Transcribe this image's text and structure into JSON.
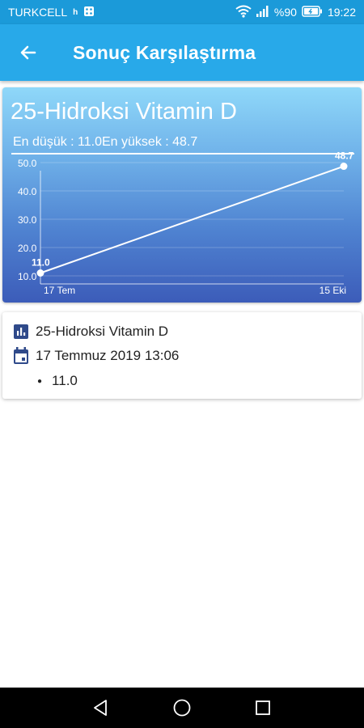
{
  "status_bar": {
    "carrier": "TURKCELL",
    "network_type": "h",
    "battery": "%90",
    "time": "19:22",
    "icons": [
      "sim-icon",
      "wifi-icon",
      "signal-icon",
      "battery-icon"
    ]
  },
  "app_bar": {
    "title": "Sonuç Karşılaştırma",
    "back_icon": "arrow-left-icon"
  },
  "chart_card": {
    "title": "25-Hidroksi Vitamin D",
    "range_text": "En düşük : 11.0En yüksek : 48.7",
    "background_colors": [
      "#8fd8f9",
      "#3c5cb9"
    ]
  },
  "chart_data": {
    "type": "line",
    "x": [
      "17 Tem",
      "15 Eki"
    ],
    "values": [
      11.0,
      48.7
    ],
    "point_labels": [
      "11.0",
      "48.7"
    ],
    "y_ticks": [
      "10.0",
      "20.0",
      "30.0",
      "40.0",
      "50.0"
    ],
    "ylim": [
      10,
      50
    ],
    "grid": true,
    "line_color": "#ffffff"
  },
  "result_card": {
    "test_name": "25-Hidroksi Vitamin D",
    "date": "17 Temmuz 2019 13:06",
    "values": [
      "11.0"
    ],
    "icons": [
      "bar-chart-icon",
      "calendar-icon"
    ],
    "icon_color": "#2f4a8a"
  },
  "nav_bar": {
    "icons": [
      "back-triangle-icon",
      "home-circle-icon",
      "recents-square-icon"
    ]
  }
}
